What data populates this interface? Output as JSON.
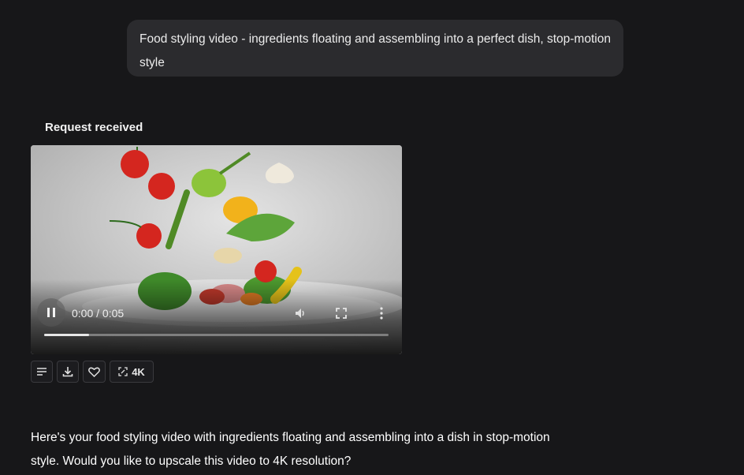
{
  "user_message": {
    "text": "Food styling video - ingredients floating and assembling into a perfect dish, stop-motion style"
  },
  "assistant": {
    "status": "Request received",
    "video": {
      "time_display": "0:00 / 0:05",
      "progress_fraction": 0.13,
      "state": "playing"
    },
    "actions": {
      "upscale_label": "4K"
    },
    "reply_text": "Here's your food styling video with ingredients floating and assembling into a dish in stop-motion style. Would you like to upscale this video to 4K resolution?"
  },
  "icons": {
    "pause": "pause-icon",
    "volume": "volume-icon",
    "fullscreen": "fullscreen-icon",
    "more": "more-vertical-icon",
    "details": "details-lines-icon",
    "download": "download-icon",
    "favorite": "heart-icon",
    "upscale": "upscale-icon"
  },
  "colors": {
    "background": "#171719",
    "bubble": "#2b2b2e",
    "text": "#ececec"
  }
}
